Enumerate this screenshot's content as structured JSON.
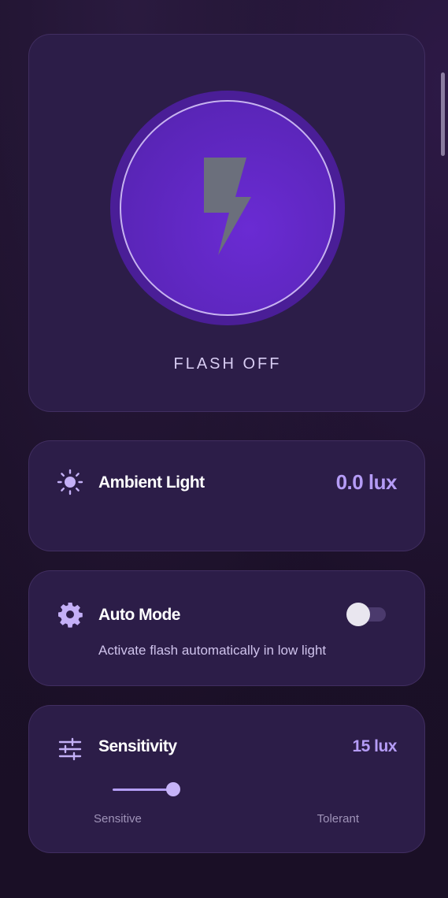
{
  "flash": {
    "label": "FLASH OFF",
    "icon": "lightning-bolt-icon",
    "state": "off",
    "colors": {
      "ring": "#4a1e97",
      "button": "#5a25b8",
      "bolt": "#6b6f7c"
    }
  },
  "ambient": {
    "icon": "sun-icon",
    "title": "Ambient Light",
    "value": "0.0 lux"
  },
  "auto_mode": {
    "icon": "gear-icon",
    "title": "Auto Mode",
    "description": "Activate flash automatically in low light",
    "enabled": false
  },
  "sensitivity": {
    "icon": "sliders-icon",
    "title": "Sensitivity",
    "value": "15 lux",
    "level": 0.1,
    "min_label": "Sensitive",
    "max_label": "Tolerant"
  },
  "theme": {
    "accent": "#b59cf6",
    "card": "#2c1d48",
    "background": "#1b1028"
  }
}
